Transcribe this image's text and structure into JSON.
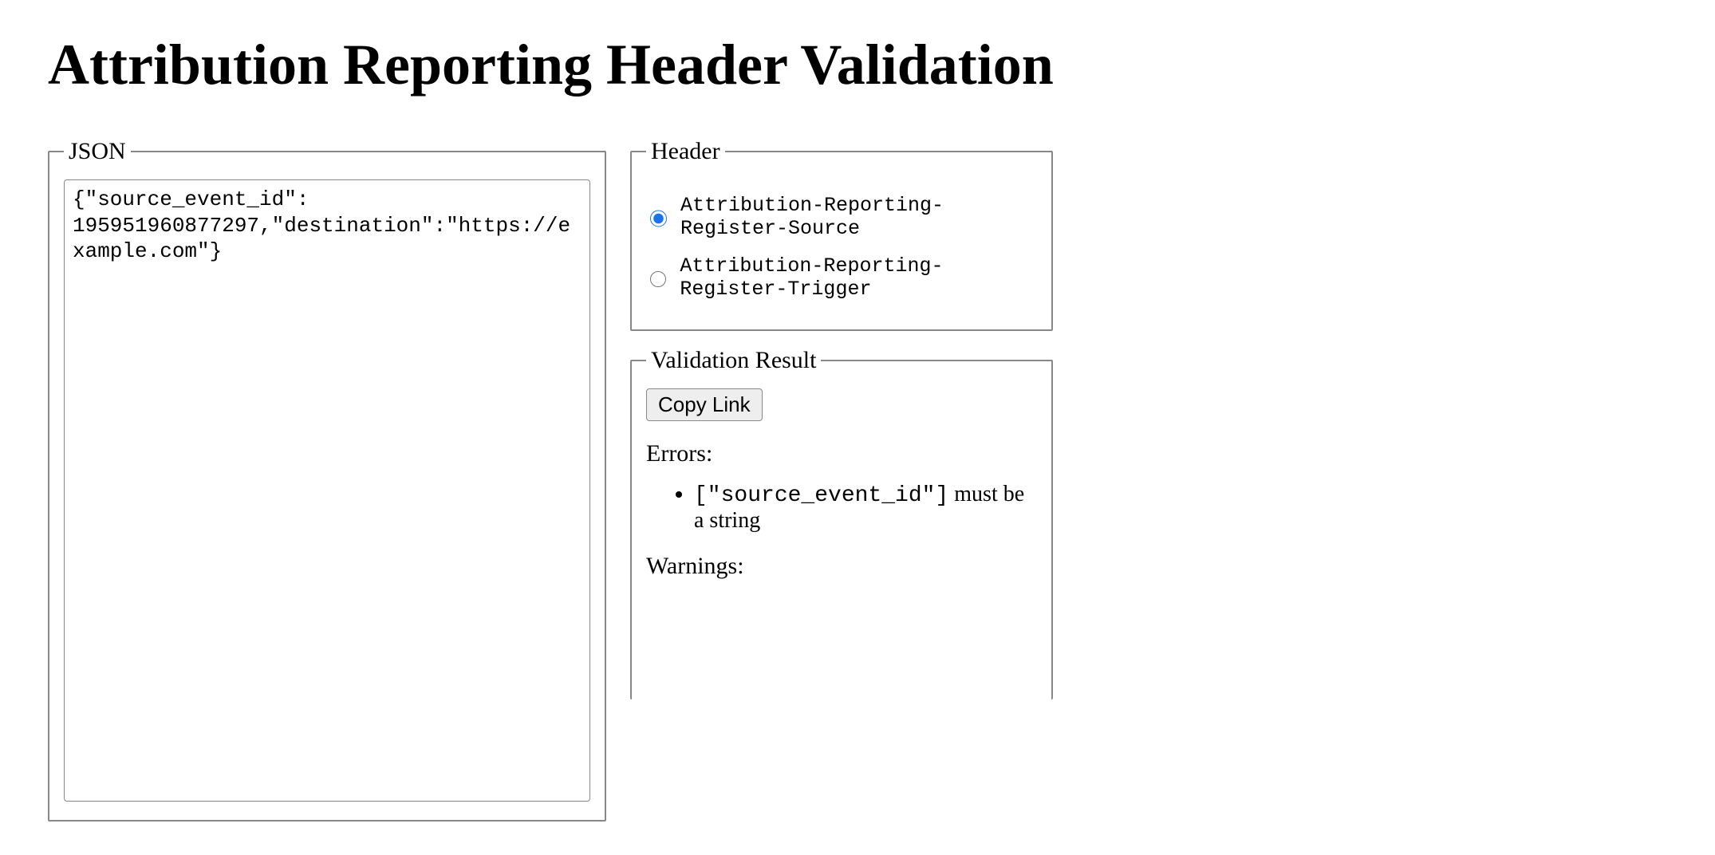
{
  "title": "Attribution Reporting Header Validation",
  "json_panel": {
    "legend": "JSON",
    "value": "{\"source_event_id\": 195951960877297,\"destination\":\"https://example.com\"}"
  },
  "header_panel": {
    "legend": "Header",
    "options": [
      {
        "label": "Attribution-Reporting-Register-Source",
        "checked": true
      },
      {
        "label": "Attribution-Reporting-Register-Trigger",
        "checked": false
      }
    ]
  },
  "result_panel": {
    "legend": "Validation Result",
    "copy_button": "Copy Link",
    "errors_label": "Errors:",
    "errors": [
      {
        "path": "[\"source_event_id\"]",
        "message": "must be a string"
      }
    ],
    "warnings_label": "Warnings:",
    "warnings": []
  }
}
